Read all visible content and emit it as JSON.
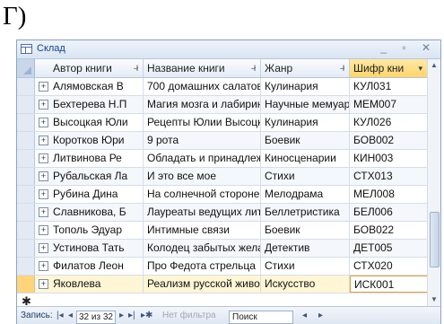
{
  "caption": "Г)",
  "window": {
    "title": "Склад",
    "controls": "_ ▫ ✕"
  },
  "columns": [
    {
      "label": "Автор книги",
      "sort": "-ł"
    },
    {
      "label": "Название книги",
      "sort": "-ł"
    },
    {
      "label": "Жанр",
      "sort": "-ł"
    },
    {
      "label": "Шифр кни",
      "sort": "▾"
    }
  ],
  "rows": [
    {
      "author": "Алямовская В",
      "title": "700 домашних салатов",
      "genre": "Кулинария",
      "code": "КУЛ031"
    },
    {
      "author": "Бехтерева Н.П",
      "title": "Магия мозга и лабиринты",
      "genre": "Научные мемуары",
      "code": "МЕМ007"
    },
    {
      "author": "Высоцкая Юли",
      "title": "Рецепты Юлии Высоцкой",
      "genre": "Кулинария",
      "code": "КУЛ026"
    },
    {
      "author": "Коротков Юри",
      "title": "9 рота",
      "genre": "Боевик",
      "code": "БОВ002"
    },
    {
      "author": "Литвинова Ре",
      "title": "Обладать и принадлежать",
      "genre": "Киносценарии",
      "code": "КИН003"
    },
    {
      "author": "Рубальская Ла",
      "title": "И это все мое",
      "genre": "Стихи",
      "code": "СТХ013"
    },
    {
      "author": "Рубина Дина",
      "title": "На солнечной стороне",
      "genre": "Мелодрама",
      "code": "МЕЛ008"
    },
    {
      "author": "Славникова, Б",
      "title": "Лауреаты ведущих литер",
      "genre": "Беллетристика",
      "code": "БЕЛ006"
    },
    {
      "author": "Тополь Эдуар",
      "title": "Интимные связи",
      "genre": "Боевик",
      "code": "БОВ022"
    },
    {
      "author": "Устинова Тать",
      "title": "Колодец забытых желаний",
      "genre": "Детектив",
      "code": "ДЕТ005"
    },
    {
      "author": "Филатов Леон",
      "title": "Про Федота стрельца",
      "genre": "Стихи",
      "code": "СТХ020"
    },
    {
      "author": "Яковлева",
      "title": "Реализм русской живописи",
      "genre": "Искусство",
      "code": "ИСК001"
    }
  ],
  "new_row_marker": "✱",
  "current_row_index": 11,
  "navigation": {
    "label": "Запись:",
    "first": "|◂",
    "prev": "◂",
    "record": "32 из 32",
    "next": "▸",
    "last": "▸|",
    "new": "▸✱",
    "filter": "Нет фильтра",
    "search": "Поиск"
  },
  "colors": {
    "accent": "#ffd56b",
    "border": "#8fa4c2",
    "title_text": "#15428b"
  }
}
